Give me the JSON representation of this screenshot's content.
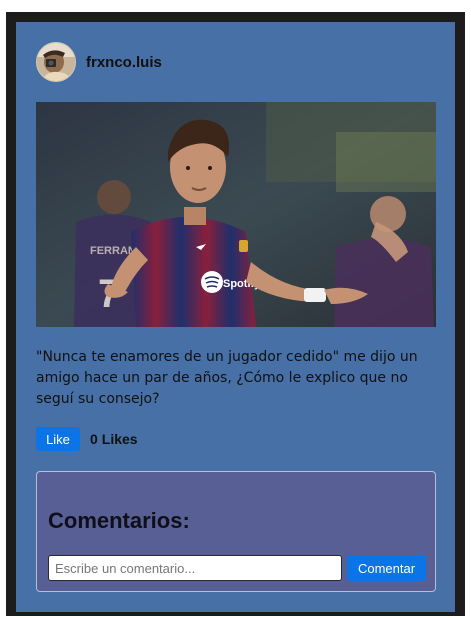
{
  "post": {
    "username": "frxnco.luis",
    "caption": "\"Nunca te enamores de un jugador cedido\" me dijo un amigo hace un par de años, ¿Cómo le explico que no seguí su consejo?",
    "like_label": "Like",
    "likes_count": "0",
    "likes_label": "Likes"
  },
  "photo": {
    "jersey_number": "7",
    "jersey_name": "FERRAN",
    "sponsor": "Spotify"
  },
  "comments": {
    "title": "Comentarios:",
    "placeholder": "Escribe un comentario...",
    "button_label": "Comentar"
  },
  "colors": {
    "card_background": "#4670a6",
    "comments_background": "#575f94",
    "button_blue": "#0b74e6"
  }
}
